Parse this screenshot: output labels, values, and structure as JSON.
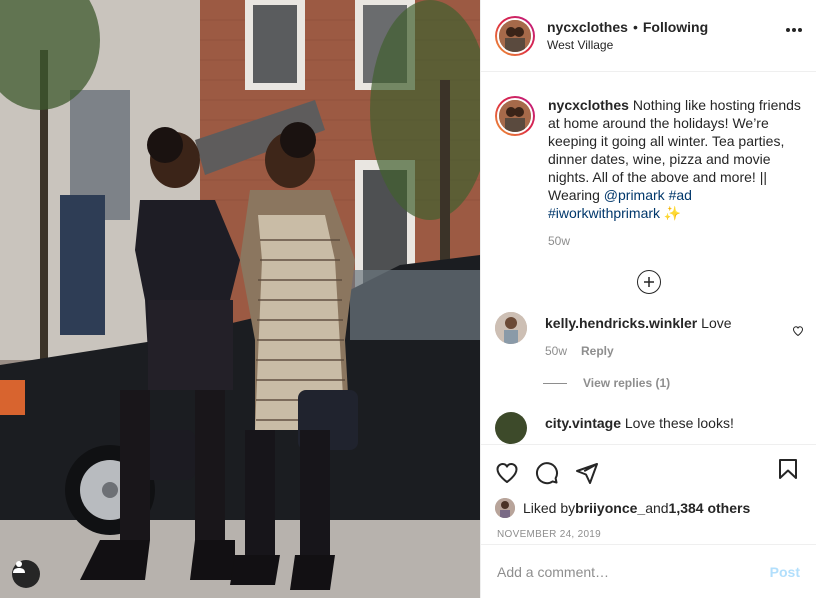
{
  "post": {
    "photo_alt": "",
    "header": {
      "username": "nycxclothes",
      "separator": "•",
      "following": "Following",
      "location": "West Village"
    },
    "caption": {
      "username": "nycxclothes",
      "text": " Nothing like hosting friends at home around the holidays! We’re keeping it going all winter. Tea parties, dinner dates, wine, pizza and movie nights. All of the above and more! || Wearing ",
      "mention": "@primark",
      "space": " ",
      "hashtag1": "#ad",
      "hashtag2": "#iworkwithprimark",
      "emoji": " ✨",
      "time": "50w"
    },
    "comments": [
      {
        "username": "kelly.hendricks.winkler",
        "text": " Love",
        "time": "50w",
        "reply": "Reply",
        "view_replies": "View replies (1)"
      },
      {
        "username": "city.vintage",
        "text": " Love these looks!"
      }
    ],
    "likes": {
      "prefix": "Liked by ",
      "user": "briiyonce_",
      "middle": " and ",
      "count": "1,384 others"
    },
    "date": "NOVEMBER 24, 2019",
    "add_comment": {
      "placeholder": "Add a comment…",
      "post_label": "Post"
    },
    "icons": {
      "like": "heart-icon",
      "comment": "comment-icon",
      "share": "share-icon",
      "save": "bookmark-icon",
      "more": "more-icon",
      "load_more": "plus-circle-icon",
      "tag": "user-tag-icon"
    },
    "colors": {
      "link": "#00376b",
      "secondary": "#8e8e8e",
      "post_disabled": "#b2dffc"
    }
  }
}
